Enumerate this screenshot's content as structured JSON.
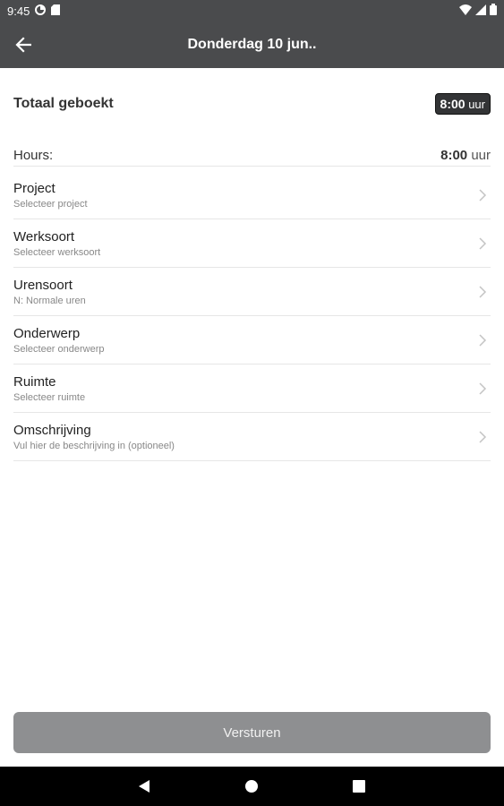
{
  "status_bar": {
    "time": "9:45"
  },
  "app_bar": {
    "title": "Donderdag 10 jun.."
  },
  "total": {
    "label": "Totaal geboekt",
    "value": "8:00",
    "unit": "uur"
  },
  "hours": {
    "label": "Hours:",
    "value": "8:00",
    "unit": "uur"
  },
  "form_items": [
    {
      "label": "Project",
      "sub": "Selecteer project"
    },
    {
      "label": "Werksoort",
      "sub": "Selecteer werksoort"
    },
    {
      "label": "Urensoort",
      "sub": "N: Normale uren"
    },
    {
      "label": "Onderwerp",
      "sub": "Selecteer onderwerp"
    },
    {
      "label": "Ruimte",
      "sub": "Selecteer ruimte"
    },
    {
      "label": "Omschrijving",
      "sub": "Vul hier de beschrijving in (optioneel)"
    }
  ],
  "submit": {
    "label": "Versturen"
  },
  "icons": {
    "back": "arrow-left-icon",
    "chevron": "chevron-right-icon",
    "nav_back": "triangle-back-icon",
    "nav_home": "circle-home-icon",
    "nav_recents": "square-recents-icon"
  },
  "colors": {
    "app_bar": "#4a4b4d",
    "button": "#8e8f91",
    "badge": "#333436"
  }
}
